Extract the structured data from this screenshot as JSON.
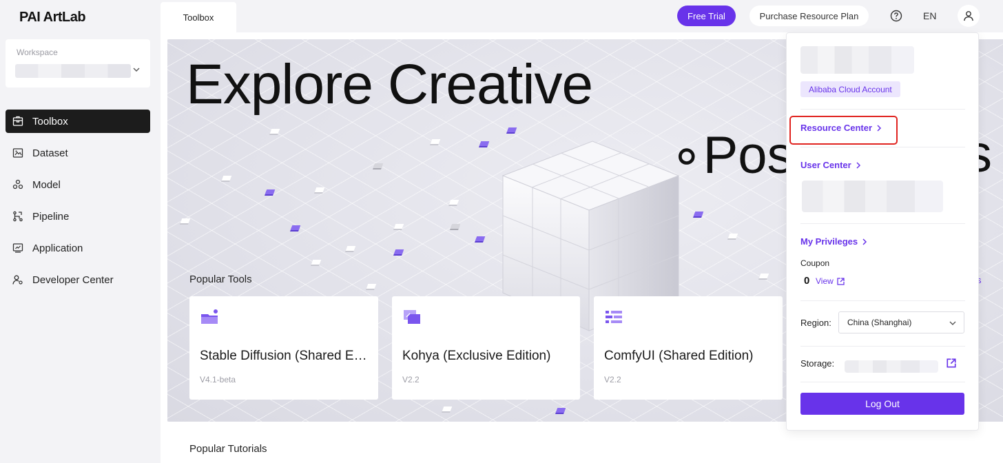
{
  "app": {
    "logo": "PAI ArtLab"
  },
  "workspace": {
    "label": "Workspace"
  },
  "sidebar": {
    "items": [
      {
        "label": "Toolbox",
        "icon": "toolbox-icon",
        "active": true
      },
      {
        "label": "Dataset",
        "icon": "dataset-icon"
      },
      {
        "label": "Model",
        "icon": "model-icon"
      },
      {
        "label": "Pipeline",
        "icon": "pipeline-icon"
      },
      {
        "label": "Application",
        "icon": "application-icon"
      },
      {
        "label": "Developer Center",
        "icon": "developer-center-icon"
      }
    ]
  },
  "topbar": {
    "tab": "Toolbox",
    "free_trial": "Free Trial",
    "purchase": "Purchase Resource Plan",
    "language": "EN"
  },
  "hero": {
    "title": "Explore Creative",
    "subtitle_left": "∘Pos",
    "subtitle_right": "s",
    "more_link": "s"
  },
  "sections": {
    "popular_tools": "Popular Tools",
    "popular_tutorials": "Popular Tutorials"
  },
  "tools": [
    {
      "title": "Stable Diffusion (Shared Edition)",
      "version": "V4.1-beta",
      "icon": "stable-diffusion-icon"
    },
    {
      "title": "Kohya (Exclusive Edition)",
      "version": "V2.2",
      "icon": "kohya-icon"
    },
    {
      "title": "ComfyUI (Shared Edition)",
      "version": "V2.2",
      "icon": "comfyui-icon"
    }
  ],
  "user_panel": {
    "account_badge": "Alibaba Cloud Account",
    "resource_center": "Resource Center",
    "user_center": "User Center",
    "my_privileges": "My Privileges",
    "coupon_label": "Coupon",
    "coupon_count": "0",
    "coupon_view": "View",
    "region_label": "Region:",
    "region_value": "China (Shanghai)",
    "storage_label": "Storage:",
    "logout": "Log Out"
  },
  "colors": {
    "accent": "#6833ea",
    "highlight": "#e0231f"
  }
}
